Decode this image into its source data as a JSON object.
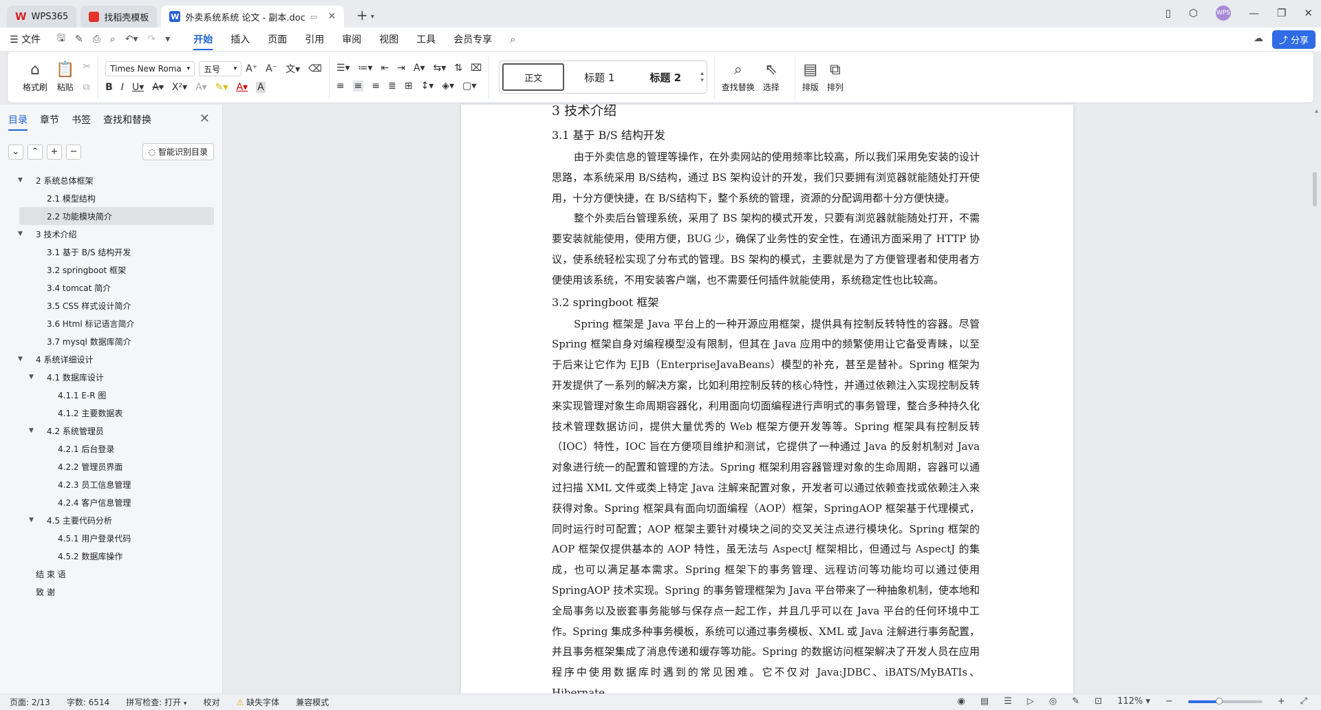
{
  "tabs": [
    {
      "label": "WPS365"
    },
    {
      "label": "找稻壳模板"
    },
    {
      "label": "外卖系统系统 论文 - 副本.doc"
    }
  ],
  "avatar_label": "WPS",
  "menu": {
    "file": "文件",
    "items": [
      "开始",
      "插入",
      "页面",
      "引用",
      "审阅",
      "视图",
      "工具",
      "会员专享"
    ],
    "share": "分享"
  },
  "ribbon": {
    "format_painter": "格式刷",
    "paste": "粘贴",
    "font_name": "Times New Roma",
    "font_size": "五号",
    "styles": [
      "正文",
      "标题 1",
      "标题 2"
    ],
    "find_replace": "查找替换",
    "select": "选择",
    "layout": "排版",
    "arrange": "排列"
  },
  "sidebar": {
    "tabs": [
      "目录",
      "章节",
      "书签",
      "查找和替换"
    ],
    "smart_toc": "智能识别目录",
    "toc": [
      {
        "label": "2 系统总体框架",
        "level": 0,
        "caret": true
      },
      {
        "label": "2.1 模型结构",
        "level": 1
      },
      {
        "label": "2.2 功能模块简介",
        "level": 1,
        "selected": true
      },
      {
        "label": "3 技术介绍",
        "level": 0,
        "caret": true
      },
      {
        "label": "3.1 基于 B/S 结构开发",
        "level": 1
      },
      {
        "label": "3.2 springboot 框架",
        "level": 1
      },
      {
        "label": "3.4 tomcat 简介",
        "level": 1
      },
      {
        "label": "3.5 CSS 样式设计简介",
        "level": 1
      },
      {
        "label": "3.6 Html 标记语言简介",
        "level": 1
      },
      {
        "label": "3.7 mysql 数据库简介",
        "level": 1
      },
      {
        "label": "4 系统详细设计",
        "level": 0,
        "caret": true
      },
      {
        "label": "4.1 数据库设计",
        "level": 1,
        "caret": true
      },
      {
        "label": "4.1.1 E-R 图",
        "level": 2
      },
      {
        "label": "4.1.2 主要数据表",
        "level": 2
      },
      {
        "label": "4.2 系统管理员",
        "level": 1,
        "caret": true
      },
      {
        "label": "4.2.1 后台登录",
        "level": 2
      },
      {
        "label": "4.2.2 管理员界面",
        "level": 2
      },
      {
        "label": "4.2.3 员工信息管理",
        "level": 2
      },
      {
        "label": "4.2.4 客户信息管理",
        "level": 2
      },
      {
        "label": "4.5 主要代码分析",
        "level": 1,
        "caret": true
      },
      {
        "label": "4.5.1 用户登录代码",
        "level": 2
      },
      {
        "label": "4.5.2 数据库操作",
        "level": 2
      },
      {
        "label": "结 束 语",
        "level": 0
      },
      {
        "label": "致    谢",
        "level": 0
      }
    ]
  },
  "document": {
    "h_main": "3 技术介绍",
    "h_31": "3.1 基于 B/S 结构开发",
    "p1": "由于外卖信息的管理等操作，在外卖网站的使用频率比较高，所以我们采用免安装的设计思路，本系统采用 B/S结构，通过 BS 架构设计的开发，我们只要拥有浏览器就能随处打开使用，十分方便快捷，在 B/S结构下，整个系统的管理，资源的分配调用都十分方便快捷。",
    "p2": "整个外卖后台管理系统，采用了 BS 架构的模式开发，只要有浏览器就能随处打开，不需要安装就能使用，使用方便，BUG 少，确保了业务性的安全性，在通讯方面采用了 HTTP 协议，使系统轻松实现了分布式的管理。BS 架构的模式，主要就是为了方便管理者和使用者方便使用该系统，不用安装客户端，也不需要任何插件就能使用，系统稳定性也比较高。",
    "h_32": "3.2 springboot 框架",
    "p3": "Spring 框架是 Java 平台上的一种开源应用框架，提供具有控制反转特性的容器。尽管 Spring 框架自身对编程模型没有限制，但其在 Java 应用中的频繁使用让它备受青睐，以至于后来让它作为 EJB（EnterpriseJavaBeans）模型的补充，甚至是替补。Spring 框架为开发提供了一系列的解决方案，比如利用控制反转的核心特性，并通过依赖注入实现控制反转来实现管理对象生命周期容器化，利用面向切面编程进行声明式的事务管理，整合多种持久化技术管理数据访问，提供大量优秀的 Web 框架方便开发等等。Spring 框架具有控制反转（IOC）特性，IOC 旨在方便项目维护和测试，它提供了一种通过 Java 的反射机制对 Java 对象进行统一的配置和管理的方法。Spring 框架利用容器管理对象的生命周期，容器可以通过扫描 XML 文件或类上特定 Java 注解来配置对象，开发者可以通过依赖查找或依赖注入来获得对象。Spring 框架具有面向切面编程（AOP）框架，SpringAOP 框架基于代理模式，同时运行时可配置；AOP 框架主要针对模块之间的交叉关注点进行模块化。Spring 框架的 AOP 框架仅提供基本的 AOP 特性，虽无法与 AspectJ 框架相比，但通过与 AspectJ 的集成，也可以满足基本需求。Spring 框架下的事务管理、远程访问等功能均可以通过使用 SpringAOP 技术实现。Spring 的事务管理框架为 Java 平台带来了一种抽象机制，使本地和全局事务以及嵌套事务能够与保存点一起工作，并且几乎可以在 Java 平台的任何环境中工作。Spring 集成多种事务模板，系统可以通过事务模板、XML 或 Java 注解进行事务配置，并且事务框架集成了消息传递和缓存等功能。Spring 的数据访问框架解决了开发人员在应用程序中使用数据库时遇到的常见困难。它不仅对 Java:JDBC、iBATS/MyBATIs、Hibernate、"
  },
  "status": {
    "page": "页面: 2/13",
    "words": "字数: 6514",
    "spell": "拼写检查: 打开",
    "proof": "校对",
    "missing_font": "缺失字体",
    "compat": "兼容模式",
    "zoom": "112%",
    "zoom_fraction": 0.42
  }
}
